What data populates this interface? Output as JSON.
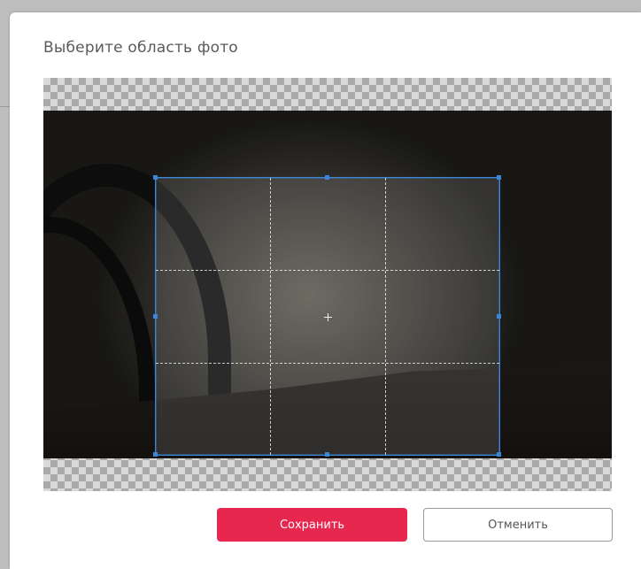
{
  "dialog": {
    "title": "Выберите область фото"
  },
  "buttons": {
    "save_label": "Сохранить",
    "cancel_label": "Отменить"
  },
  "colors": {
    "accent": "#e8274f",
    "crop_border": "#3a86d9"
  },
  "icons": {
    "center": "crosshair-icon"
  }
}
